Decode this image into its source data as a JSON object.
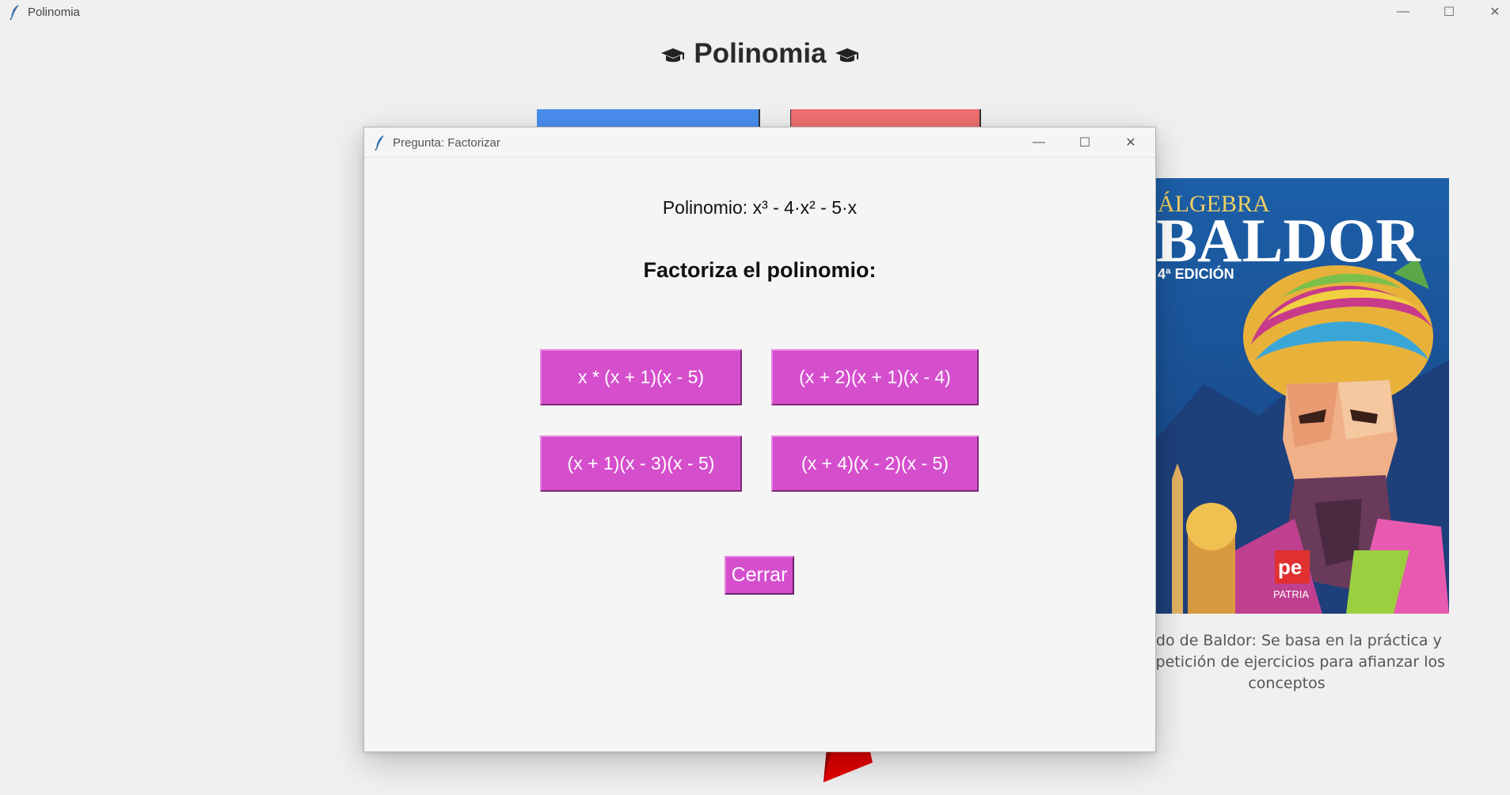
{
  "main_window": {
    "title": "Polinomia",
    "heading": "Polinomia",
    "controls": {
      "minimize": "—",
      "maximize": "☐",
      "close": "✕"
    }
  },
  "book": {
    "cover": {
      "line1": "ÁLGEBRA",
      "line2": "BALDOR",
      "edition": "4ª EDICIÓN",
      "publisher": "PATRIA"
    },
    "caption": "étodo de Baldor: Se basa en la práctica y la epetición de ejercicios para afianzar los conceptos"
  },
  "dialog": {
    "title": "Pregunta: Factorizar",
    "polynomial": "Polinomio: x³  - 4·x²  - 5·x",
    "instruction": "Factoriza el polinomio:",
    "options": [
      "x * (x + 1)(x - 5)",
      "(x + 2)(x + 1)(x - 4)",
      "(x + 1)(x - 3)(x - 5)",
      "(x + 4)(x - 2)(x - 5)"
    ],
    "close_label": "Cerrar",
    "controls": {
      "minimize": "—",
      "maximize": "☐",
      "close": "✕"
    }
  },
  "colors": {
    "accent_button": "#d54fcd",
    "bar_blue": "#4a8ef0",
    "bar_red": "#f07070",
    "pointer": "#e00000"
  },
  "icons": [
    "feather-icon",
    "graduation-cap-icon"
  ]
}
